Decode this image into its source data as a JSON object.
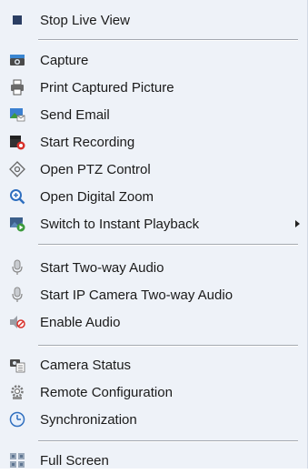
{
  "menu": {
    "items": [
      {
        "label": "Stop Live View",
        "icon": "stop-icon"
      },
      {
        "label": "Capture",
        "icon": "camera-icon"
      },
      {
        "label": "Print Captured Picture",
        "icon": "printer-icon"
      },
      {
        "label": "Send Email",
        "icon": "email-icon"
      },
      {
        "label": "Start Recording",
        "icon": "record-icon"
      },
      {
        "label": "Open PTZ Control",
        "icon": "ptz-icon"
      },
      {
        "label": "Open Digital Zoom",
        "icon": "zoom-icon"
      },
      {
        "label": "Switch to Instant Playback",
        "icon": "instant-playback-icon"
      },
      {
        "label": "Start Two-way Audio",
        "icon": "microphone-icon"
      },
      {
        "label": "Start IP Camera Two-way Audio",
        "icon": "ip-camera-microphone-icon"
      },
      {
        "label": "Enable Audio",
        "icon": "speaker-muted-icon"
      },
      {
        "label": "Camera Status",
        "icon": "camera-status-icon"
      },
      {
        "label": "Remote Configuration",
        "icon": "remote-config-icon"
      },
      {
        "label": "Synchronization",
        "icon": "clock-sync-icon"
      },
      {
        "label": "Full Screen",
        "icon": "fullscreen-icon"
      }
    ]
  },
  "colors": {
    "menu_background": "#eef2f8",
    "text": "#1a1a1a",
    "separator": "#a3a8b0",
    "icon_blue": "#2f6fbf",
    "icon_red": "#d8302a",
    "icon_green": "#3b9a3b"
  }
}
